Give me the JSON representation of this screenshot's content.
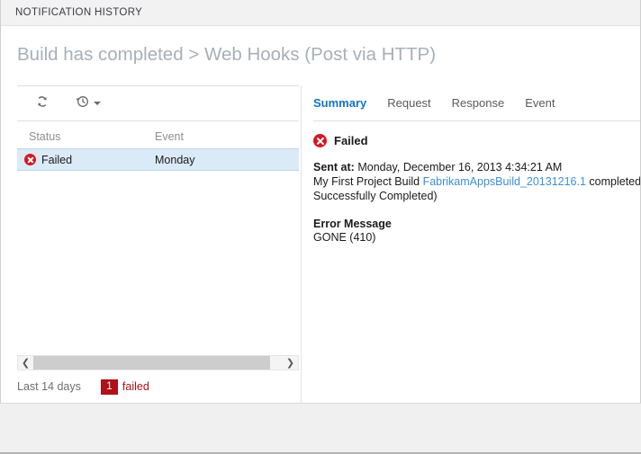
{
  "window": {
    "title": "NOTIFICATION HISTORY",
    "heading": "Build has completed > Web Hooks (Post via HTTP)"
  },
  "toolbar": {
    "refresh_icon": "refresh-icon",
    "refresh_label": "Refresh",
    "history_icon": "clock-history-icon",
    "history_label": "History range",
    "caret_icon": "chevron-down-icon"
  },
  "list": {
    "columns": [
      "Status",
      "Event"
    ],
    "rows": [
      {
        "status_icon": "error-circle-icon",
        "status": "Failed",
        "event": "Monday",
        "selected": true
      }
    ]
  },
  "scrollbar": {
    "left_arrow": "❮",
    "right_arrow": "❯"
  },
  "statusbar": {
    "range": "Last 14 days",
    "failed_count": "1",
    "failed_label": "failed"
  },
  "details": {
    "tabs": [
      {
        "label": "Summary",
        "active": true
      },
      {
        "label": "Request",
        "active": false
      },
      {
        "label": "Response",
        "active": false
      },
      {
        "label": "Event",
        "active": false
      }
    ],
    "status_icon": "error-circle-icon",
    "status": "Failed",
    "sent_label": "Sent at:",
    "sent_value": "Monday, December 16, 2013 4:34:21 AM",
    "message_prefix": "My First Project Build ",
    "message_link": "FabrikamAppsBuild_20131216.1",
    "message_suffix": " completed (Sta",
    "message_line2": "Successfully Completed)",
    "error_heading": "Error Message",
    "error_text": "GONE (410)"
  },
  "colors": {
    "accent": "#1074c4",
    "error": "#d51820",
    "badge": "#b01018",
    "selection": "#dbeaf7",
    "link": "#3d8fd6"
  }
}
